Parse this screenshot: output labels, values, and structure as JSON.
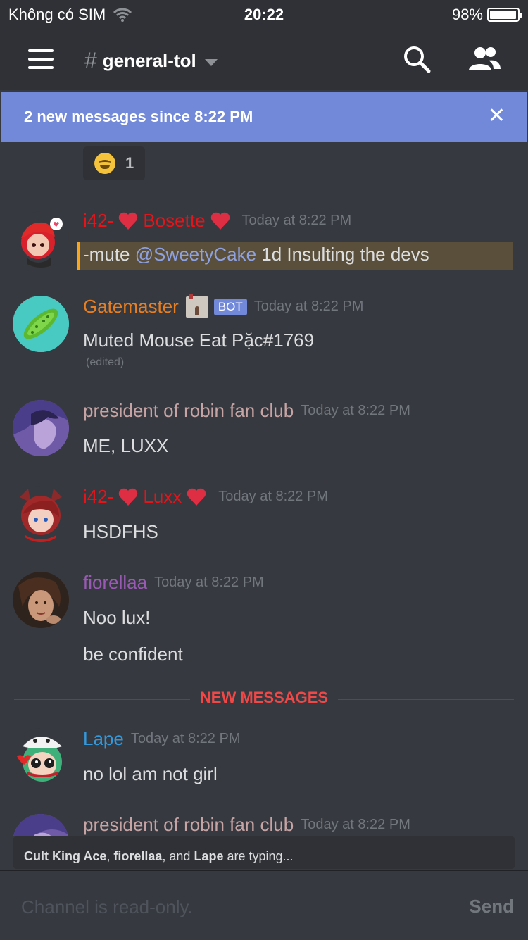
{
  "status_bar": {
    "carrier": "Không có SIM",
    "time": "20:22",
    "battery": "98%"
  },
  "nav": {
    "hash": "#",
    "channel_name": "general-tol"
  },
  "banner": {
    "text": "2 new messages since 8:22 PM",
    "close": "✕"
  },
  "reaction": {
    "count": "1"
  },
  "messages": [
    {
      "prefix": "i42-",
      "name": "Bosette",
      "name_color": "#e3151a",
      "time": "Today at 8:22 PM",
      "content_pre": "-mute ",
      "mention": "@SweetyCake",
      "content_post": " 1d Insulting the devs"
    },
    {
      "name": "Gatemaster",
      "name_color": "#e67e22",
      "badge": "BOT",
      "time": "Today at 8:22 PM",
      "content": "Muted Mouse Eat Pặc#1769",
      "edited": "(edited)"
    },
    {
      "name": "president of robin fan club",
      "name_color": "#c7a4a4",
      "time": "Today at 8:22 PM",
      "content": "ME, LUXX"
    },
    {
      "prefix": "i42-",
      "name": "Luxx",
      "name_color": "#e3151a",
      "time": "Today at 8:22 PM",
      "content": "HSDFHS"
    },
    {
      "name": "fiorellaa",
      "name_color": "#9b59b6",
      "time": "Today at 8:22 PM",
      "content": "Noo lux!",
      "content2": "be confident"
    },
    {
      "name": "Lape",
      "name_color": "#3498db",
      "time": "Today at 8:22 PM",
      "content": "no lol am not girl"
    },
    {
      "name": "president of robin fan club",
      "name_color": "#c7a4a4",
      "time": "Today at 8:22 PM"
    }
  ],
  "divider": "NEW MESSAGES",
  "typing": {
    "user1": "Cult King Ace",
    "sep1": ", ",
    "user2": "fiorellaa",
    "sep2": ", and ",
    "user3": "Lape",
    "suffix": " are typing..."
  },
  "composer": {
    "placeholder": "Channel is read-only.",
    "send": "Send"
  }
}
